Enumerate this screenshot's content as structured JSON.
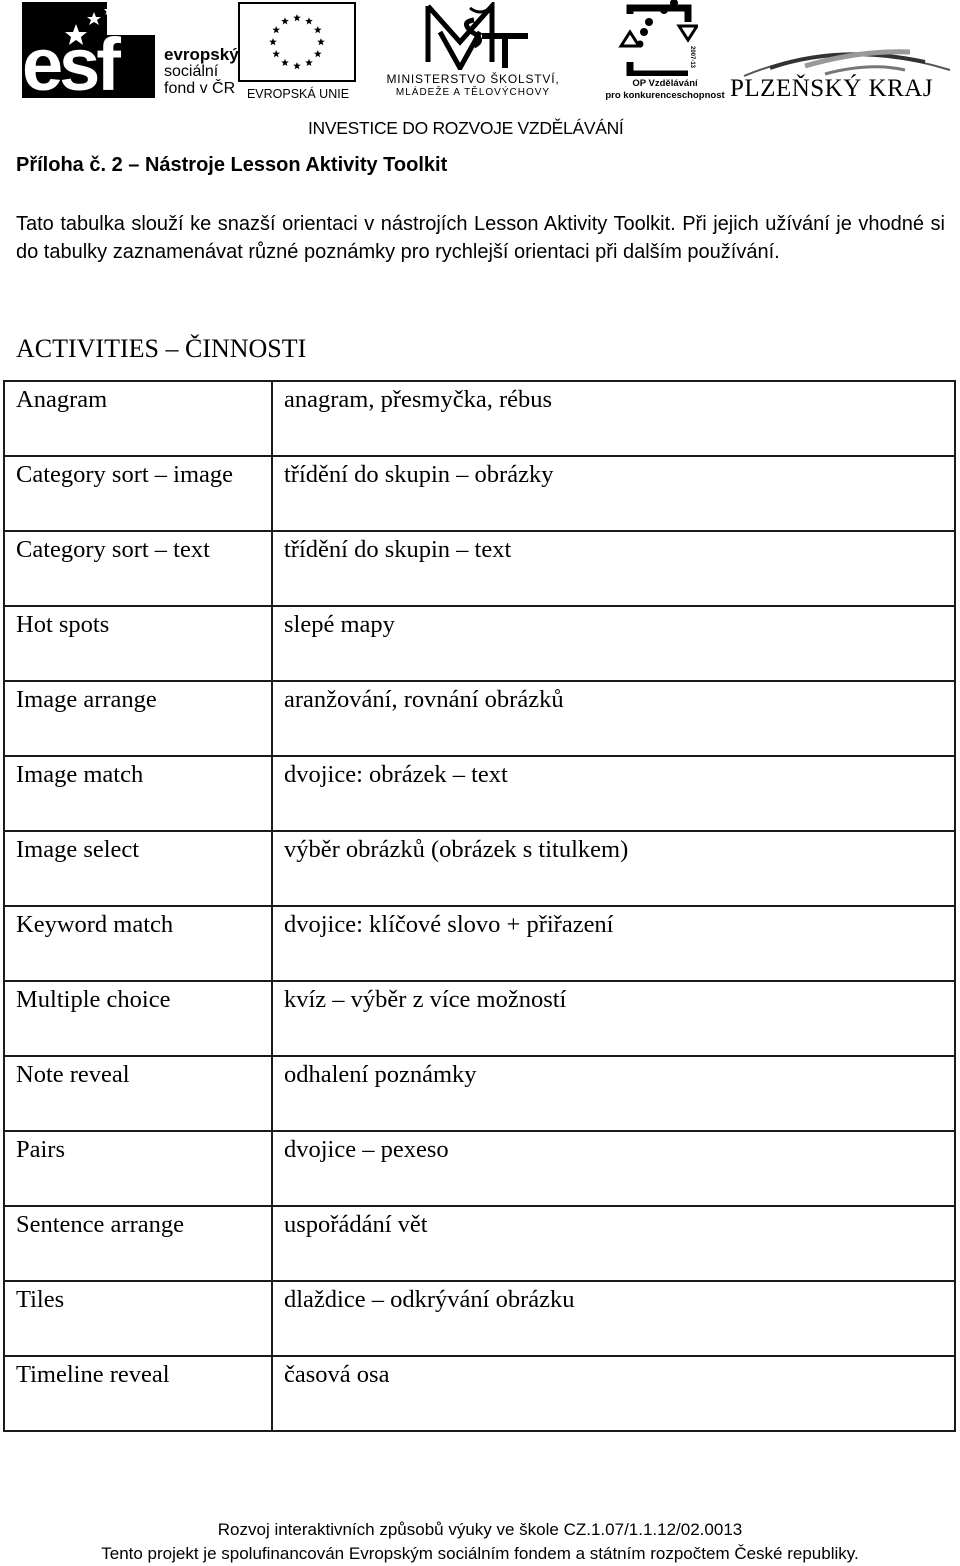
{
  "header": {
    "logos": {
      "esf": {
        "mark": "esf",
        "line1": "evropský",
        "line2": "sociální",
        "line3": "fond v ČR"
      },
      "eu": {
        "label": "EVROPSKÁ UNIE"
      },
      "msmt": {
        "mark": "MŠMT",
        "line1": "MINISTERSTVO ŠKOLSTVÍ,",
        "line2": "MLÁDEŽE A TĚLOVÝCHOVY"
      },
      "op": {
        "line1": "OP Vzdělávání",
        "line2": "pro konkurenceschopnost",
        "years": "2007-13"
      },
      "kraj": {
        "label": "PLZEŇSKÝ KRAJ"
      }
    },
    "slogan": "INVESTICE DO ROZVOJE VZDĚLÁVÁNÍ"
  },
  "document": {
    "title": "Příloha č. 2 – Nástroje Lesson Aktivity Toolkit",
    "intro": "Tato tabulka slouží ke snazší orientaci v nástrojích Lesson Aktivity Toolkit. Při jejich užívání je vhodné si do tabulky zaznamenávat různé poznámky pro rychlejší orientaci při dalším používání.",
    "section_heading": "ACTIVITIES – ČINNOSTI"
  },
  "table": {
    "rows": [
      {
        "activity": "Anagram",
        "description": "anagram, přesmyčka, rébus"
      },
      {
        "activity": "Category sort – image",
        "description": "třídění do skupin – obrázky"
      },
      {
        "activity": "Category sort – text",
        "description": "třídění do skupin – text"
      },
      {
        "activity": "Hot spots",
        "description": "slepé mapy"
      },
      {
        "activity": "Image arrange",
        "description": "aranžování, rovnání obrázků"
      },
      {
        "activity": "Image match",
        "description": "dvojice:  obrázek – text"
      },
      {
        "activity": "Image select",
        "description": "výběr obrázků (obrázek s titulkem)"
      },
      {
        "activity": "Keyword match",
        "description": "dvojice: klíčové slovo  + přiřazení"
      },
      {
        "activity": "Multiple choice",
        "description": "kvíz – výběr z více možností"
      },
      {
        "activity": "Note reveal",
        "description": "odhalení poznámky"
      },
      {
        "activity": "Pairs",
        "description": "dvojice – pexeso"
      },
      {
        "activity": "Sentence arrange",
        "description": "uspořádání vět"
      },
      {
        "activity": "Tiles",
        "description": "dlaždice – odkrývání obrázku"
      },
      {
        "activity": "Timeline reveal",
        "description": "časová osa"
      }
    ]
  },
  "footer": {
    "line1": "Rozvoj interaktivních způsobů výuky ve škole CZ.1.07/1.1.12/02.0013",
    "line2": "Tento projekt je spolufinancován Evropským sociálním fondem a státním rozpočtem České republiky."
  }
}
